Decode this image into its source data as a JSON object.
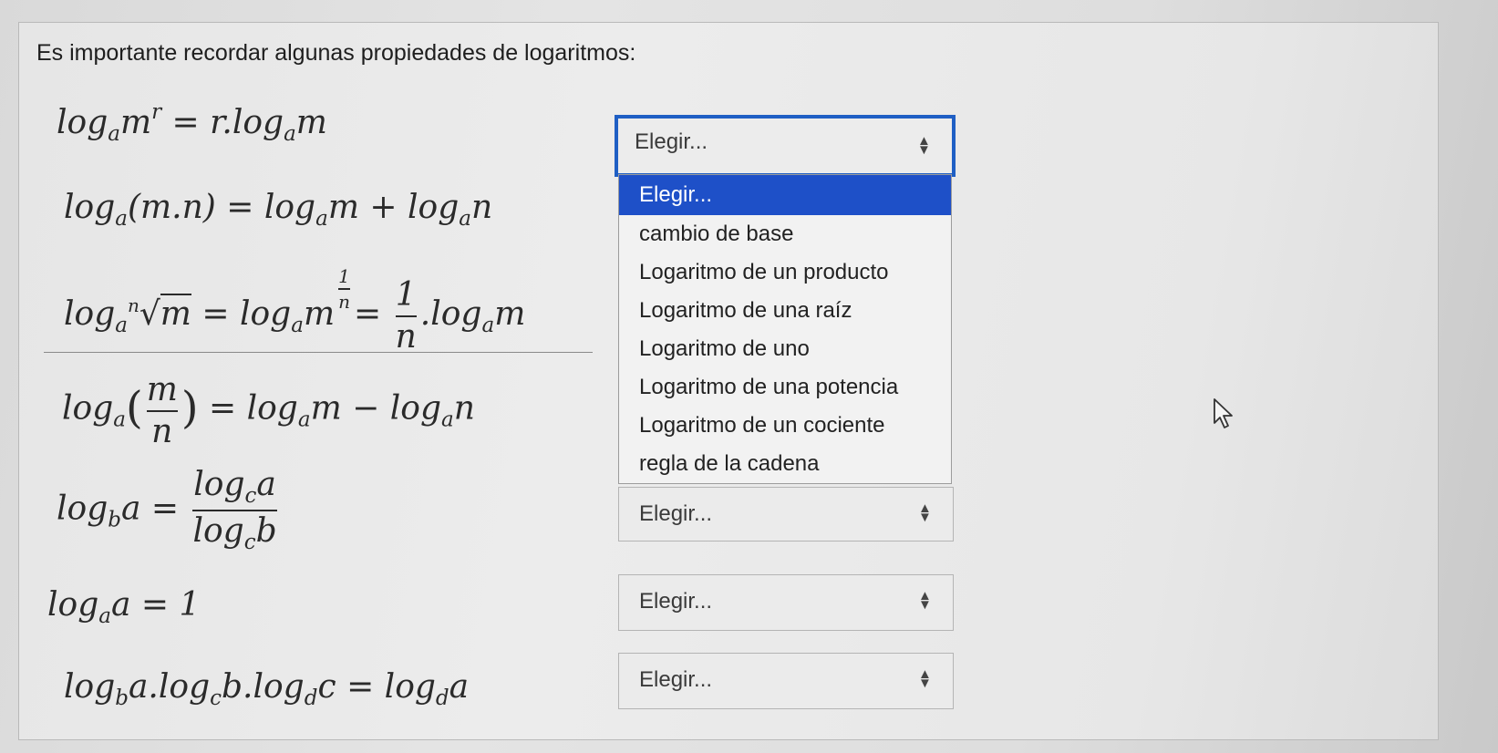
{
  "intro": "Es importante recordar algunas propiedades de logaritmos:",
  "formulas": [
    "log_a m^r = r.log_a m",
    "log_a(m.n) = log_a m + log_a n",
    "log_a ⁿ√m = log_a m^(1/n) = (1/n).log_a m",
    "log_a(m/n) = log_a m − log_a n",
    "log_b a = log_c a / log_c b",
    "log_a a = 1",
    "log_b a.log_c b.log_d c = log_d a"
  ],
  "selects": [
    {
      "value": "Elegir..."
    },
    {
      "value": "Elegir..."
    },
    {
      "value": "Elegir..."
    },
    {
      "value": "Elegir..."
    }
  ],
  "dropdown": {
    "options": [
      "Elegir...",
      "cambio de base",
      "Logaritmo de un producto",
      "Logaritmo de una raíz",
      "Logaritmo de uno",
      "Logaritmo de una potencia",
      "Logaritmo de un cociente",
      "regla de la cadena"
    ],
    "selected_index": 0
  },
  "icons": {
    "select_arrow": "updown-arrows-icon",
    "cursor": "mouse-pointer-icon"
  }
}
